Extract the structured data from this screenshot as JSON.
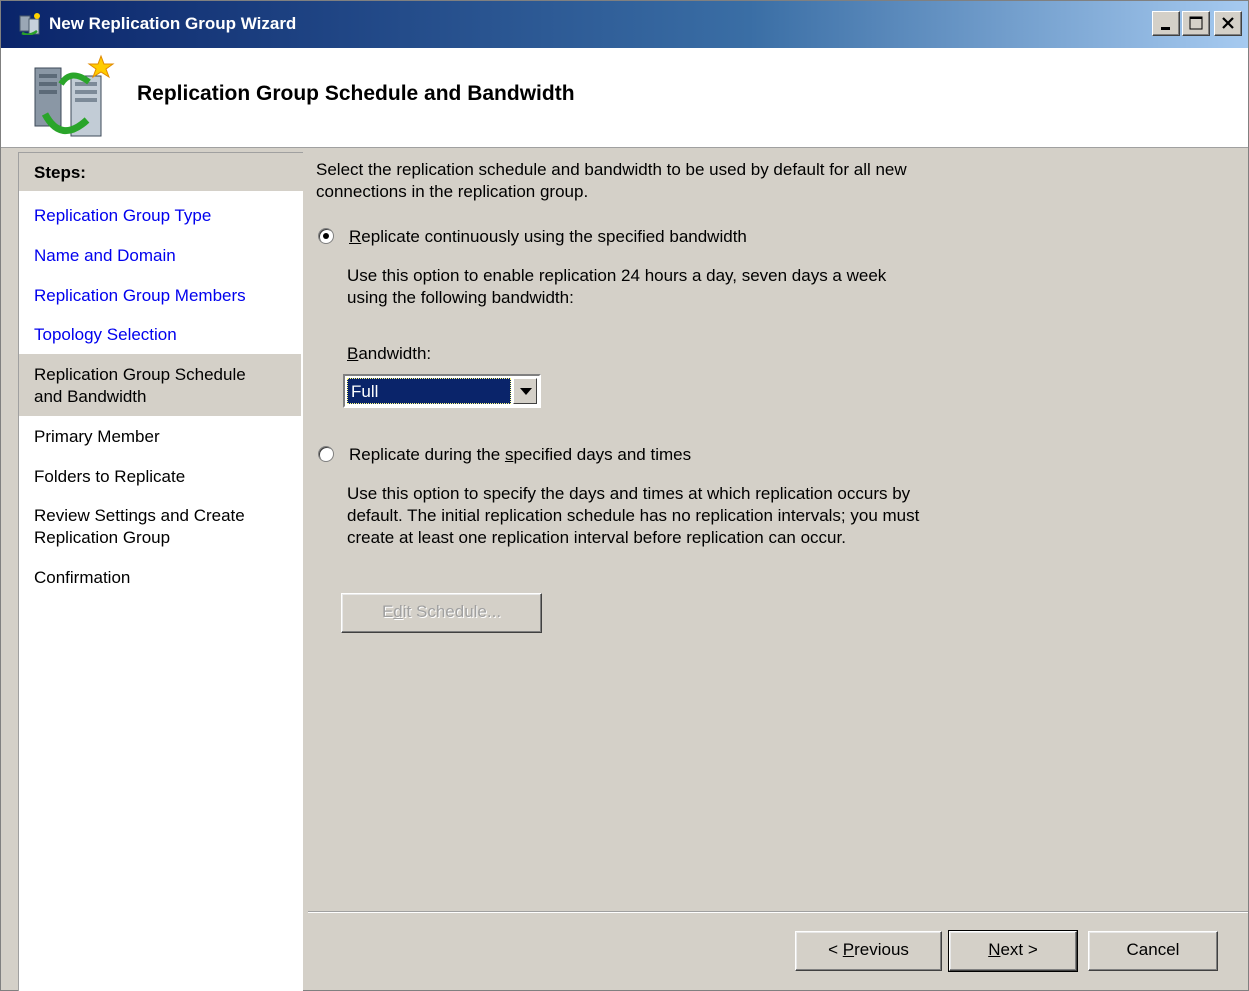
{
  "window": {
    "title": "New Replication Group Wizard",
    "buttons": {
      "minimize": "_",
      "maximize": "□",
      "close": "×"
    }
  },
  "header": {
    "title": "Replication Group Schedule and Bandwidth"
  },
  "steps": {
    "heading": "Steps:",
    "items": [
      {
        "label": "Replication Group Type",
        "state": "completed"
      },
      {
        "label": "Name and Domain",
        "state": "completed"
      },
      {
        "label": "Replication Group Members",
        "state": "completed"
      },
      {
        "label": "Topology Selection",
        "state": "completed"
      },
      {
        "label_line1": "Replication Group Schedule",
        "label_line2": "and Bandwidth",
        "state": "current"
      },
      {
        "label": "Primary Member",
        "state": "pending"
      },
      {
        "label": "Folders to Replicate",
        "state": "pending"
      },
      {
        "label_line1": "Review Settings and Create",
        "label_line2": "Replication Group",
        "state": "pending"
      },
      {
        "label": "Confirmation",
        "state": "pending"
      }
    ]
  },
  "main": {
    "intro_line1": "Select the replication schedule and bandwidth to be used by default for all new",
    "intro_line2": "connections in the replication group.",
    "option_continuous": {
      "label_prefix": "",
      "label_accel": "R",
      "label_rest": "eplicate continuously using the specified bandwidth",
      "selected": true,
      "desc_line1": "Use this option to enable replication 24 hours a day, seven days a week",
      "desc_line2": "using the following bandwidth:"
    },
    "bandwidth": {
      "label_accel": "B",
      "label_rest": "andwidth:",
      "value": "Full"
    },
    "option_schedule": {
      "label_prefix": "Replicate during the ",
      "label_accel": "s",
      "label_rest": "pecified days and times",
      "selected": false,
      "desc_line1": "Use this option to specify the days and times at which replication occurs by",
      "desc_line2": "default. The initial replication schedule has no replication intervals; you must",
      "desc_line3": "create at least one replication interval before replication can occur."
    },
    "edit_schedule": {
      "prefix": "E",
      "accel": "d",
      "rest": "it Schedule..."
    }
  },
  "footer": {
    "previous": {
      "prefix": "< ",
      "accel": "P",
      "rest": "revious"
    },
    "next": {
      "accel": "N",
      "rest": "ext >"
    },
    "cancel": "Cancel"
  },
  "colors": {
    "titlebar": "#0a246a",
    "link": "#0000ee",
    "face": "#d4d0c8",
    "selection": "#0a246a"
  }
}
